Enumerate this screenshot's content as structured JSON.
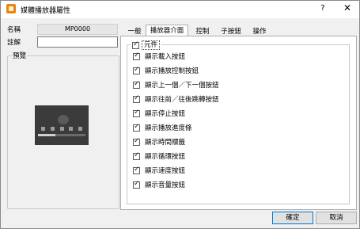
{
  "window": {
    "title": "媒體播放器屬性",
    "help": "?",
    "close": "✕"
  },
  "fields": {
    "name_label": "名稱",
    "name_value": "MP0000",
    "comment_label": "註解",
    "comment_value": ""
  },
  "preview": {
    "title": "預覽"
  },
  "tabs": [
    "一般",
    "播放器介面",
    "控制",
    "子按鈕",
    "操作"
  ],
  "active_tab_index": 1,
  "component_group": {
    "label": "元件",
    "checked": true
  },
  "options": [
    {
      "label": "顯示載入按鈕",
      "checked": true
    },
    {
      "label": "顯示播放控制按鈕",
      "checked": true
    },
    {
      "label": "顯示上一個／下一個按鈕",
      "checked": true
    },
    {
      "label": "顯示往前／往後跳轉按鈕",
      "checked": true
    },
    {
      "label": "顯示停止按鈕",
      "checked": true
    },
    {
      "label": "顯示播放進度條",
      "checked": true
    },
    {
      "label": "顯示時間標籤",
      "checked": true
    },
    {
      "label": "顯示循環按鈕",
      "checked": true
    },
    {
      "label": "顯示速度按鈕",
      "checked": true
    },
    {
      "label": "顯示音量按鈕",
      "checked": true
    }
  ],
  "buttons": {
    "ok": "確定",
    "cancel": "取消"
  },
  "colors": {
    "accent": "#0078d7",
    "dialog_bg": "#f0f0f0",
    "icon": "#e8841a"
  }
}
